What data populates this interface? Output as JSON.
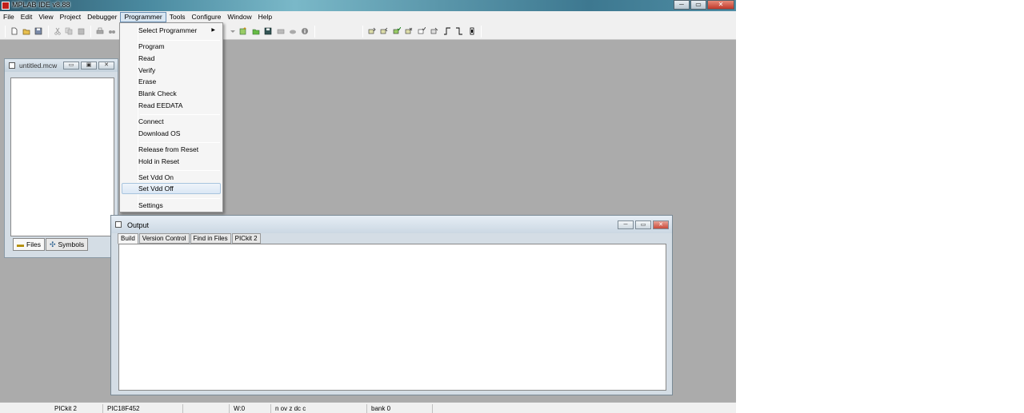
{
  "window": {
    "title": "MPLAB IDE v8.88",
    "minimize": "─",
    "maximize": "▭",
    "close": "✕"
  },
  "menubar": {
    "items": [
      "File",
      "Edit",
      "View",
      "Project",
      "Debugger",
      "Programmer",
      "Tools",
      "Configure",
      "Window",
      "Help"
    ],
    "active": "Programmer"
  },
  "programmer_menu": {
    "select_programmer": "Select Programmer",
    "submenu_arrow": "▶",
    "program": "Program",
    "read": "Read",
    "verify": "Verify",
    "erase": "Erase",
    "blank_check": "Blank Check",
    "read_eedata": "Read EEDATA",
    "connect": "Connect",
    "download_os": "Download OS",
    "release_from_reset": "Release from Reset",
    "hold_in_reset": "Hold in Reset",
    "set_vdd_on": "Set Vdd On",
    "set_vdd_off": "Set Vdd Off",
    "settings": "Settings",
    "highlighted": "Set Vdd Off"
  },
  "workspace": {
    "title": "untitled.mcw",
    "tab_files": "Files",
    "tab_symbols": "Symbols",
    "btn_min": "▭",
    "btn_max": "▣",
    "btn_close": "✕"
  },
  "output": {
    "title": "Output",
    "tabs": [
      "Build",
      "Version Control",
      "Find in Files",
      "PICkit 2"
    ],
    "selected_tab": "Build",
    "btn_min": "─",
    "btn_max": "▭",
    "btn_close": "✕"
  },
  "statusbar": {
    "programmer": "PICkit 2",
    "device": "PIC18F452",
    "wreg": "W:0",
    "flags": "n ov z dc c",
    "bank": "bank 0"
  }
}
